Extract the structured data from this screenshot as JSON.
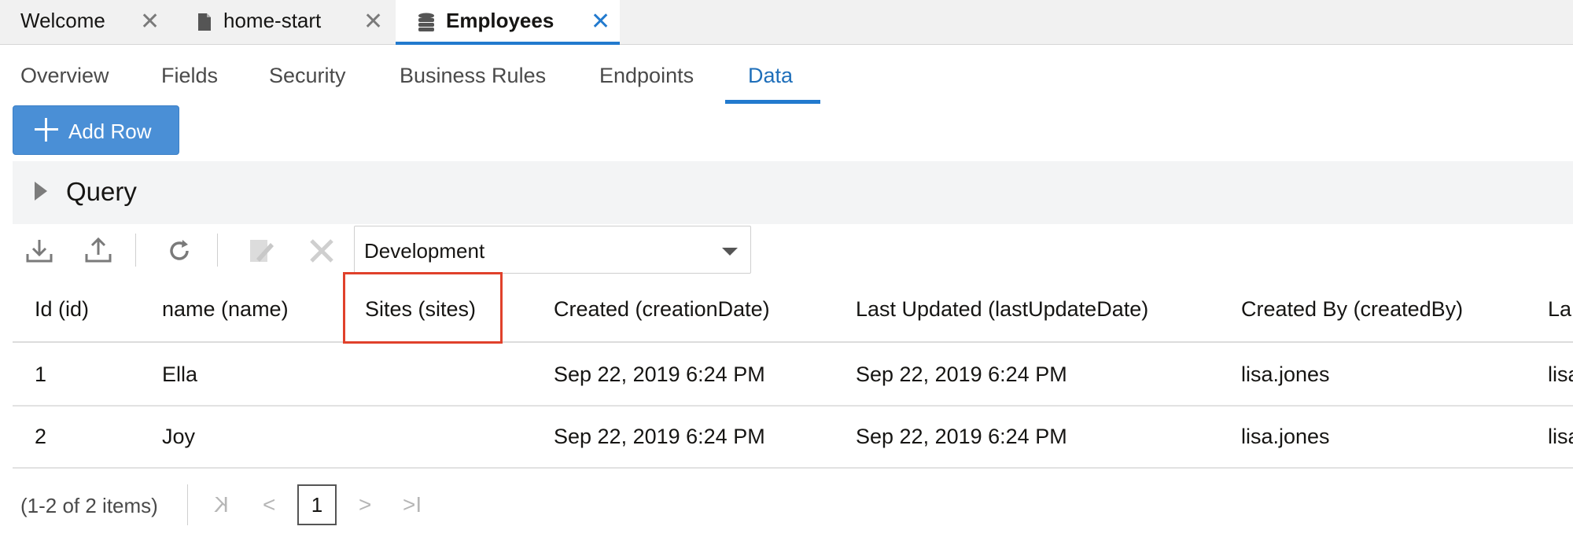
{
  "editor_tabs": [
    {
      "label": "Welcome"
    },
    {
      "label": "home-start"
    },
    {
      "label": "Employees"
    }
  ],
  "close_glyph": "✕",
  "subtabs": [
    {
      "label": "Overview"
    },
    {
      "label": "Fields"
    },
    {
      "label": "Security"
    },
    {
      "label": "Business Rules"
    },
    {
      "label": "Endpoints"
    },
    {
      "label": "Data"
    }
  ],
  "add_row_label": "Add Row",
  "query": {
    "title": "Query"
  },
  "toolbar": {
    "icons": [
      "download-icon",
      "upload-icon",
      "refresh-icon",
      "edit-icon",
      "delete-icon"
    ],
    "environment": "Development"
  },
  "table": {
    "columns": [
      "Id (id)",
      "name (name)",
      "Sites (sites)",
      "Created (creationDate)",
      "Last Updated (lastUpdateDate)",
      "Created By (createdBy)",
      "La"
    ],
    "rows": [
      [
        "1",
        "Ella",
        "",
        "Sep 22, 2019 6:24 PM",
        "Sep 22, 2019 6:24 PM",
        "lisa.jones",
        "lisa"
      ],
      [
        "2",
        "Joy",
        "",
        "Sep 22, 2019 6:24 PM",
        "Sep 22, 2019 6:24 PM",
        "lisa.jones",
        "lisa"
      ]
    ]
  },
  "pager": {
    "info": "(1-2 of 2 items)",
    "current_page": "1",
    "first": "K",
    "prev": "<",
    "next": ">",
    "last": ">I"
  },
  "colors": {
    "accent": "#227ace",
    "button": "#4a8fd6",
    "highlight_box": "#e0412b"
  }
}
